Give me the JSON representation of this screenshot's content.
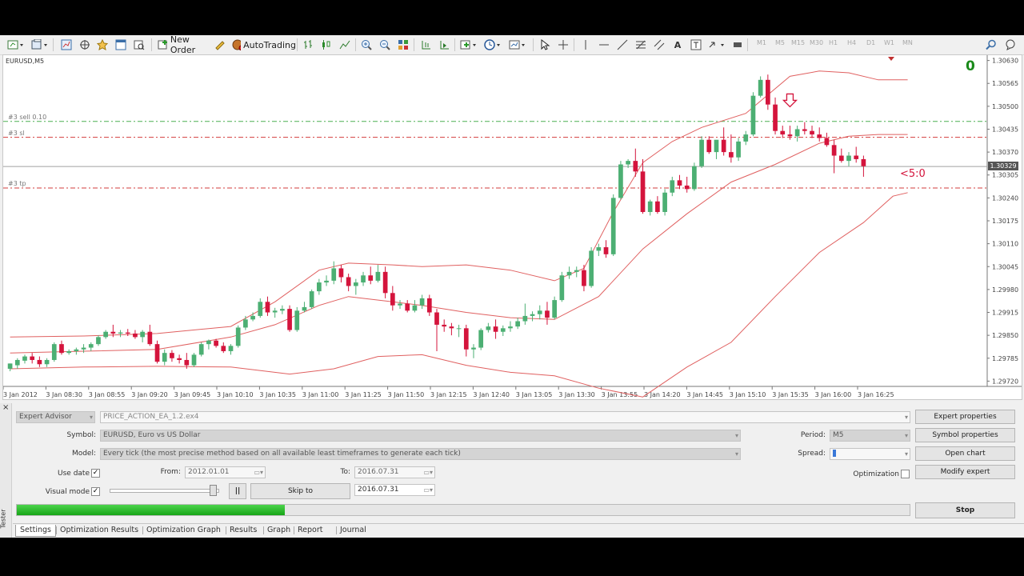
{
  "toolbar": {
    "new_order": "New Order",
    "auto_trading": "AutoTrading",
    "timeframes": [
      "M1",
      "M5",
      "M15",
      "M30",
      "H1",
      "H4",
      "D1",
      "W1",
      "MN"
    ]
  },
  "chart": {
    "symbol": "EURUSD,M5",
    "zero_label": "0",
    "order_lines": [
      {
        "label": "#3 sell 0.10",
        "price": 1.30457,
        "color": "#4caf50"
      },
      {
        "label": "#3 sl",
        "price": 1.30412,
        "color": "#d23c3c"
      },
      {
        "label": "#3 tp",
        "price": 1.30268,
        "color": "#d23c3c"
      }
    ],
    "bid_price": "1.30329",
    "counter_label": "<5:0",
    "bull_color": "#4caf73",
    "bear_color": "#d4143c",
    "band_color": "#e06060"
  },
  "chart_data": {
    "type": "candlestick",
    "title": "",
    "y_ticks": [
      "1.30630",
      "1.30565",
      "1.30500",
      "1.30435",
      "1.30370",
      "1.30305",
      "1.30240",
      "1.30175",
      "1.30110",
      "1.30045",
      "1.29980",
      "1.29915",
      "1.29850",
      "1.29785",
      "1.29720"
    ],
    "x_ticks": [
      "3 Jan 2012",
      "3 Jan 08:30",
      "3 Jan 08:55",
      "3 Jan 09:20",
      "3 Jan 09:45",
      "3 Jan 10:10",
      "3 Jan 10:35",
      "3 Jan 11:00",
      "3 Jan 11:25",
      "3 Jan 11:50",
      "3 Jan 12:15",
      "3 Jan 12:40",
      "3 Jan 13:05",
      "3 Jan 13:30",
      "3 Jan 13:55",
      "3 Jan 14:20",
      "3 Jan 14:45",
      "3 Jan 15:10",
      "3 Jan 15:35",
      "3 Jan 16:00",
      "3 Jan 16:25"
    ],
    "ylim": [
      1.29705,
      1.30645
    ],
    "candles": [
      [
        1.29755,
        1.2977,
        1.29748,
        1.2977
      ],
      [
        1.29765,
        1.29785,
        1.29755,
        1.2978
      ],
      [
        1.29778,
        1.29795,
        1.2977,
        1.2979
      ],
      [
        1.2979,
        1.298,
        1.2977,
        1.2978
      ],
      [
        1.2978,
        1.2979,
        1.2976,
        1.29768
      ],
      [
        1.29768,
        1.29785,
        1.2976,
        1.2978
      ],
      [
        1.2978,
        1.2983,
        1.29775,
        1.29825
      ],
      [
        1.29825,
        1.29835,
        1.29795,
        1.298
      ],
      [
        1.298,
        1.2981,
        1.29795,
        1.29805
      ],
      [
        1.29805,
        1.29815,
        1.29795,
        1.2981
      ],
      [
        1.2981,
        1.29825,
        1.298,
        1.29815
      ],
      [
        1.29815,
        1.2983,
        1.29805,
        1.29825
      ],
      [
        1.29825,
        1.2985,
        1.2982,
        1.29845
      ],
      [
        1.29845,
        1.29865,
        1.2984,
        1.2986
      ],
      [
        1.2986,
        1.2988,
        1.29845,
        1.29855
      ],
      [
        1.29855,
        1.29865,
        1.29845,
        1.29858
      ],
      [
        1.29858,
        1.29868,
        1.29848,
        1.29855
      ],
      [
        1.29855,
        1.29865,
        1.2984,
        1.29845
      ],
      [
        1.29845,
        1.29865,
        1.2983,
        1.2986
      ],
      [
        1.2986,
        1.2988,
        1.2982,
        1.29825
      ],
      [
        1.29825,
        1.29835,
        1.2977,
        1.29775
      ],
      [
        1.29775,
        1.2981,
        1.29765,
        1.298
      ],
      [
        1.298,
        1.29808,
        1.29775,
        1.29785
      ],
      [
        1.29785,
        1.29795,
        1.2977,
        1.2978
      ],
      [
        1.2978,
        1.298,
        1.29755,
        1.29765
      ],
      [
        1.29765,
        1.298,
        1.2976,
        1.29795
      ],
      [
        1.29795,
        1.2983,
        1.2979,
        1.29825
      ],
      [
        1.29825,
        1.29838,
        1.2981,
        1.29835
      ],
      [
        1.29835,
        1.2984,
        1.29815,
        1.2982
      ],
      [
        1.2982,
        1.2983,
        1.298,
        1.29805
      ],
      [
        1.29805,
        1.29825,
        1.29795,
        1.2982
      ],
      [
        1.2982,
        1.29878,
        1.29815,
        1.29872
      ],
      [
        1.29872,
        1.29905,
        1.29865,
        1.29895
      ],
      [
        1.29895,
        1.29915,
        1.2989,
        1.29905
      ],
      [
        1.29905,
        1.29955,
        1.299,
        1.29945
      ],
      [
        1.29945,
        1.2996,
        1.29905,
        1.29915
      ],
      [
        1.29915,
        1.29928,
        1.299,
        1.2992
      ],
      [
        1.2992,
        1.29935,
        1.2991,
        1.29925
      ],
      [
        1.29925,
        1.29935,
        1.2986,
        1.29865
      ],
      [
        1.29865,
        1.2993,
        1.2986,
        1.2992
      ],
      [
        1.2992,
        1.29945,
        1.29915,
        1.2993
      ],
      [
        1.2993,
        1.2998,
        1.29925,
        1.29975
      ],
      [
        1.29975,
        1.3001,
        1.29965,
        1.3
      ],
      [
        1.3,
        1.3002,
        1.2999,
        1.30005
      ],
      [
        1.30005,
        1.3006,
        1.29995,
        1.3004
      ],
      [
        1.3004,
        1.3005,
        1.3,
        1.30015
      ],
      [
        1.30015,
        1.30025,
        1.29975,
        1.2999
      ],
      [
        1.2999,
        1.3001,
        1.29965,
        1.3
      ],
      [
        1.3,
        1.3003,
        1.2999,
        1.3002
      ],
      [
        1.3002,
        1.30045,
        1.29995,
        1.30005
      ],
      [
        1.30005,
        1.3005,
        1.3,
        1.3003
      ],
      [
        1.3003,
        1.30045,
        1.29955,
        1.2997
      ],
      [
        1.2997,
        1.2999,
        1.2992,
        1.29935
      ],
      [
        1.29935,
        1.2995,
        1.29925,
        1.2994
      ],
      [
        1.2994,
        1.2995,
        1.29915,
        1.2992
      ],
      [
        1.2992,
        1.2995,
        1.29915,
        1.29935
      ],
      [
        1.29935,
        1.29965,
        1.29925,
        1.29955
      ],
      [
        1.29955,
        1.29965,
        1.29905,
        1.29915
      ],
      [
        1.29915,
        1.29925,
        1.29805,
        1.2988
      ],
      [
        1.2988,
        1.29895,
        1.2986,
        1.29875
      ],
      [
        1.29875,
        1.29885,
        1.2985,
        1.2987
      ],
      [
        1.2987,
        1.2988,
        1.29845,
        1.2987
      ],
      [
        1.2987,
        1.2988,
        1.2979,
        1.2981
      ],
      [
        1.2981,
        1.29825,
        1.29785,
        1.29815
      ],
      [
        1.29815,
        1.2987,
        1.29808,
        1.29865
      ],
      [
        1.29865,
        1.29885,
        1.29858,
        1.29875
      ],
      [
        1.29875,
        1.29895,
        1.2984,
        1.2986
      ],
      [
        1.2986,
        1.29878,
        1.29848,
        1.2987
      ],
      [
        1.2987,
        1.2989,
        1.2986,
        1.29875
      ],
      [
        1.29875,
        1.299,
        1.29868,
        1.2989
      ],
      [
        1.2989,
        1.2994,
        1.2988,
        1.29905
      ],
      [
        1.29905,
        1.29918,
        1.2989,
        1.2991
      ],
      [
        1.2991,
        1.29935,
        1.29895,
        1.2992
      ],
      [
        1.2992,
        1.29945,
        1.2988,
        1.299
      ],
      [
        1.299,
        1.2996,
        1.29895,
        1.2995
      ],
      [
        1.2995,
        1.3003,
        1.29945,
        1.3002
      ],
      [
        1.3002,
        1.30045,
        1.3001,
        1.3003
      ],
      [
        1.3003,
        1.30045,
        1.30015,
        1.30035
      ],
      [
        1.30035,
        1.3005,
        1.29975,
        1.2999
      ],
      [
        1.2999,
        1.301,
        1.29985,
        1.3009
      ],
      [
        1.3009,
        1.3011,
        1.30075,
        1.301
      ],
      [
        1.301,
        1.3012,
        1.3007,
        1.3008
      ],
      [
        1.3008,
        1.3025,
        1.30075,
        1.3024
      ],
      [
        1.3024,
        1.30345,
        1.30235,
        1.30335
      ],
      [
        1.30335,
        1.3035,
        1.30325,
        1.30345
      ],
      [
        1.30345,
        1.3038,
        1.303,
        1.30315
      ],
      [
        1.30315,
        1.3035,
        1.30195,
        1.302
      ],
      [
        1.302,
        1.30235,
        1.3019,
        1.3023
      ],
      [
        1.3023,
        1.30245,
        1.30195,
        1.302
      ],
      [
        1.302,
        1.30265,
        1.3019,
        1.30255
      ],
      [
        1.30255,
        1.303,
        1.30245,
        1.3029
      ],
      [
        1.3029,
        1.30305,
        1.30265,
        1.30275
      ],
      [
        1.30275,
        1.303,
        1.30255,
        1.30265
      ],
      [
        1.30265,
        1.3034,
        1.3026,
        1.3033
      ],
      [
        1.3033,
        1.30415,
        1.30325,
        1.30405
      ],
      [
        1.30405,
        1.30415,
        1.30365,
        1.3037
      ],
      [
        1.3037,
        1.304,
        1.3035,
        1.30405
      ],
      [
        1.30405,
        1.3044,
        1.3036,
        1.3037
      ],
      [
        1.3037,
        1.3042,
        1.3034,
        1.30355
      ],
      [
        1.30355,
        1.3041,
        1.30345,
        1.304
      ],
      [
        1.304,
        1.3043,
        1.3039,
        1.3042
      ],
      [
        1.3042,
        1.3054,
        1.30415,
        1.3053
      ],
      [
        1.3053,
        1.30585,
        1.30525,
        1.30575
      ],
      [
        1.30575,
        1.3059,
        1.3049,
        1.30505
      ],
      [
        1.30505,
        1.30525,
        1.3042,
        1.3043
      ],
      [
        1.3043,
        1.30445,
        1.3041,
        1.3042
      ],
      [
        1.3042,
        1.30445,
        1.30405,
        1.30415
      ],
      [
        1.30415,
        1.30445,
        1.304,
        1.30435
      ],
      [
        1.30435,
        1.30455,
        1.3042,
        1.3043
      ],
      [
        1.3043,
        1.30445,
        1.3041,
        1.3042
      ],
      [
        1.3042,
        1.3044,
        1.304,
        1.3041
      ],
      [
        1.3041,
        1.30425,
        1.30385,
        1.3039
      ],
      [
        1.3039,
        1.30405,
        1.3031,
        1.3036
      ],
      [
        1.3036,
        1.3038,
        1.3034,
        1.30345
      ],
      [
        1.30345,
        1.3037,
        1.3033,
        1.3036
      ],
      [
        1.3036,
        1.30385,
        1.3034,
        1.3035
      ],
      [
        1.3035,
        1.3036,
        1.303,
        1.3033
      ]
    ],
    "bands": {
      "upper": [
        [
          0,
          1.29845
        ],
        [
          10,
          1.29848
        ],
        [
          20,
          1.29855
        ],
        [
          30,
          1.29875
        ],
        [
          36,
          1.29945
        ],
        [
          42,
          1.30035
        ],
        [
          46,
          1.30055
        ],
        [
          52,
          1.3005
        ],
        [
          56,
          1.30045
        ],
        [
          62,
          1.3005
        ],
        [
          68,
          1.30035
        ],
        [
          74,
          1.30005
        ],
        [
          78,
          1.3004
        ],
        [
          82,
          1.302
        ],
        [
          86,
          1.3034
        ],
        [
          90,
          1.304
        ],
        [
          94,
          1.3044
        ],
        [
          100,
          1.3048
        ],
        [
          106,
          1.30585
        ],
        [
          110,
          1.306
        ],
        [
          114,
          1.30595
        ],
        [
          118,
          1.30575
        ],
        [
          122,
          1.30575
        ]
      ],
      "middle": [
        [
          0,
          1.298
        ],
        [
          10,
          1.29805
        ],
        [
          20,
          1.2981
        ],
        [
          30,
          1.29845
        ],
        [
          36,
          1.2988
        ],
        [
          42,
          1.29935
        ],
        [
          46,
          1.2996
        ],
        [
          52,
          1.29945
        ],
        [
          56,
          1.29935
        ],
        [
          62,
          1.29915
        ],
        [
          68,
          1.299
        ],
        [
          74,
          1.29895
        ],
        [
          80,
          1.2996
        ],
        [
          86,
          1.30095
        ],
        [
          92,
          1.30195
        ],
        [
          98,
          1.30285
        ],
        [
          104,
          1.30335
        ],
        [
          110,
          1.30395
        ],
        [
          114,
          1.30415
        ],
        [
          118,
          1.3042
        ],
        [
          122,
          1.3042
        ]
      ],
      "lower": [
        [
          0,
          1.29755
        ],
        [
          10,
          1.2976
        ],
        [
          20,
          1.29762
        ],
        [
          30,
          1.2976
        ],
        [
          38,
          1.2974
        ],
        [
          44,
          1.29755
        ],
        [
          50,
          1.2979
        ],
        [
          56,
          1.29795
        ],
        [
          62,
          1.29765
        ],
        [
          68,
          1.29745
        ],
        [
          74,
          1.29735
        ],
        [
          80,
          1.297
        ],
        [
          86,
          1.29675
        ],
        [
          92,
          1.2976
        ],
        [
          98,
          1.2983
        ],
        [
          104,
          1.2996
        ],
        [
          110,
          1.30085
        ],
        [
          116,
          1.3017
        ],
        [
          120,
          1.30245
        ],
        [
          122,
          1.30255
        ]
      ]
    }
  },
  "tester": {
    "close_icon": "close-icon",
    "side_title": "Tester",
    "type_select": "Expert Advisor",
    "ea_file": "PRICE_ACTION_EA_1.2.ex4",
    "symbol_label": "Symbol:",
    "symbol_value": "EURUSD, Euro vs US Dollar",
    "model_label": "Model:",
    "model_value": "Every tick (the most precise method based on all available least timeframes to generate each tick)",
    "use_date_label": "Use date",
    "from_label": "From:",
    "from_value": "2012.01.01",
    "to_label": "To:",
    "to_value": "2016.07.31",
    "visual_mode_label": "Visual mode",
    "skip_to_label": "Skip to",
    "skip_to_value": "2016.07.31",
    "period_label": "Period:",
    "period_value": "M5",
    "spread_label": "Spread:",
    "optimization_label": "Optimization",
    "expert_properties": "Expert properties",
    "symbol_properties": "Symbol properties",
    "open_chart": "Open chart",
    "modify_expert": "Modify expert",
    "stop": "Stop",
    "progress": 0.3,
    "tabs": [
      "Settings",
      "Optimization Results",
      "Optimization Graph",
      "Results",
      "Graph",
      "Report",
      "Journal"
    ]
  }
}
